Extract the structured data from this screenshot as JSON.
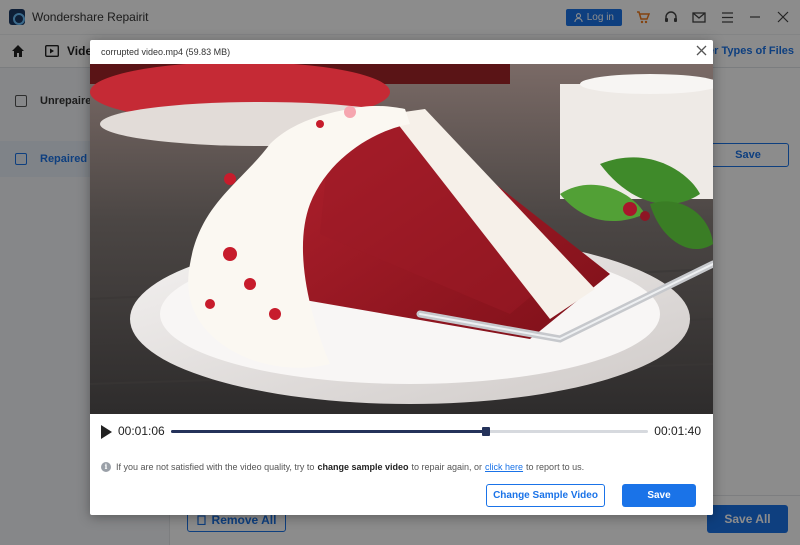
{
  "app": {
    "title": "Wondershare Repairit",
    "login_label": "Log in"
  },
  "nav": {
    "video_label": "Vide",
    "other_types_label": "ther Types of Files"
  },
  "sidebar": {
    "items": [
      {
        "label": "Unrepaire",
        "active": false
      },
      {
        "label": "Repaired F",
        "active": true
      }
    ]
  },
  "background": {
    "save_label": "Save",
    "remove_all_label": "Remove All",
    "save_all_label": "Save All"
  },
  "modal": {
    "file_name": "corrupted video.mp4",
    "file_size": "(59.83  MB)",
    "player": {
      "current_time": "00:01:06",
      "total_time": "00:01:40",
      "progress_fraction": 0.66
    },
    "notice": {
      "prefix": "If you are not satisfied with the video quality, try to",
      "bold_link": "change sample video",
      "middle": "to repair again, or",
      "link": "click here",
      "suffix": "to report to us."
    },
    "change_sample_label": "Change Sample Video",
    "save_label": "Save"
  },
  "colors": {
    "accent": "#1a73e8",
    "progress": "#24325a"
  }
}
